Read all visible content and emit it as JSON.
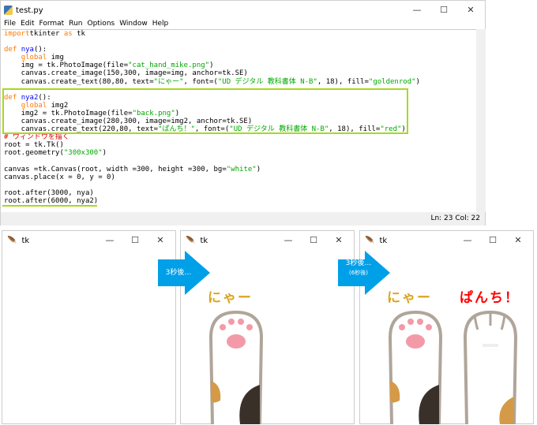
{
  "editor": {
    "title": "test.py",
    "menu": [
      "File",
      "Edit",
      "Format",
      "Run",
      "Options",
      "Window",
      "Help"
    ],
    "status": "Ln: 23  Col: 22",
    "code": [
      [
        [
          "k",
          "import"
        ],
        [
          "",
          "tkinter "
        ],
        [
          "k",
          "as"
        ],
        [
          "",
          " tk"
        ]
      ],
      [],
      [
        [
          "k",
          "def "
        ],
        [
          "f",
          "nya"
        ],
        [
          "",
          "():"
        ]
      ],
      [
        [
          "",
          "    "
        ],
        [
          "k",
          "global"
        ],
        [
          "",
          " img"
        ]
      ],
      [
        [
          "",
          "    img = tk.PhotoImage(file="
        ],
        [
          "s",
          "\"cat_hand_mike.png\""
        ],
        [
          "",
          ")"
        ]
      ],
      [
        [
          "",
          "    canvas.create_image(150,300, image=img, anchor=tk.SE)"
        ]
      ],
      [
        [
          "",
          "    canvas.create_text(80,80, text="
        ],
        [
          "s",
          "\"にゃー\""
        ],
        [
          "",
          ", font=("
        ],
        [
          "s",
          "\"UD デジタル 教科書体 N-B\""
        ],
        [
          "",
          ", 18), fill="
        ],
        [
          "s",
          "\"goldenrod\""
        ],
        [
          "",
          ")"
        ]
      ],
      [],
      [
        [
          "k",
          "def "
        ],
        [
          "f",
          "nya2"
        ],
        [
          "",
          "():"
        ]
      ],
      [
        [
          "",
          "    "
        ],
        [
          "k",
          "global"
        ],
        [
          "",
          " img2"
        ]
      ],
      [
        [
          "",
          "    img2 = tk.PhotoImage(file="
        ],
        [
          "s",
          "\"back.png\""
        ],
        [
          "",
          ")"
        ]
      ],
      [
        [
          "",
          "    canvas.create_image(280,300, image=img2, anchor=tk.SE)"
        ]
      ],
      [
        [
          "",
          "    canvas.create_text(220,80, text="
        ],
        [
          "s",
          "\"ぱんち！\""
        ],
        [
          "",
          ", font=("
        ],
        [
          "s",
          "\"UD デジタル 教科書体 N-B\""
        ],
        [
          "",
          ", 18), fill="
        ],
        [
          "s",
          "\"red\""
        ],
        [
          "",
          ")"
        ]
      ],
      [
        [
          "c",
          "# ウィンドウを描く"
        ]
      ],
      [
        [
          "",
          "root = tk.Tk()"
        ]
      ],
      [
        [
          "",
          "root.geometry("
        ],
        [
          "s",
          "\"300x300\""
        ],
        [
          "",
          ")"
        ]
      ],
      [],
      [
        [
          "",
          "canvas =tk.Canvas(root, width =300, height =300, bg="
        ],
        [
          "s",
          "\"white\""
        ],
        [
          "",
          ")"
        ]
      ],
      [
        [
          "",
          "canvas.place(x = 0, y = 0)"
        ]
      ],
      [],
      [
        [
          "",
          "root.after(3000, nya)"
        ]
      ],
      [
        [
          "",
          "root.after(6000, nya2)"
        ]
      ]
    ]
  },
  "windows": [
    {
      "title": "tk"
    },
    {
      "title": "tk",
      "texts": [
        {
          "text": "にゃー",
          "color": "#daa520"
        }
      ]
    },
    {
      "title": "tk",
      "texts": [
        {
          "text": "にゃー",
          "color": "#daa520"
        },
        {
          "text": "ぱんち！",
          "color": "#ff0000"
        }
      ]
    }
  ],
  "arrows": [
    {
      "label": "3秒後…",
      "sub": ""
    },
    {
      "label": "3秒後…",
      "sub": "(6秒後)"
    }
  ],
  "colors": {
    "arrow": "#00a0e9",
    "highlight": "#a8d820"
  }
}
